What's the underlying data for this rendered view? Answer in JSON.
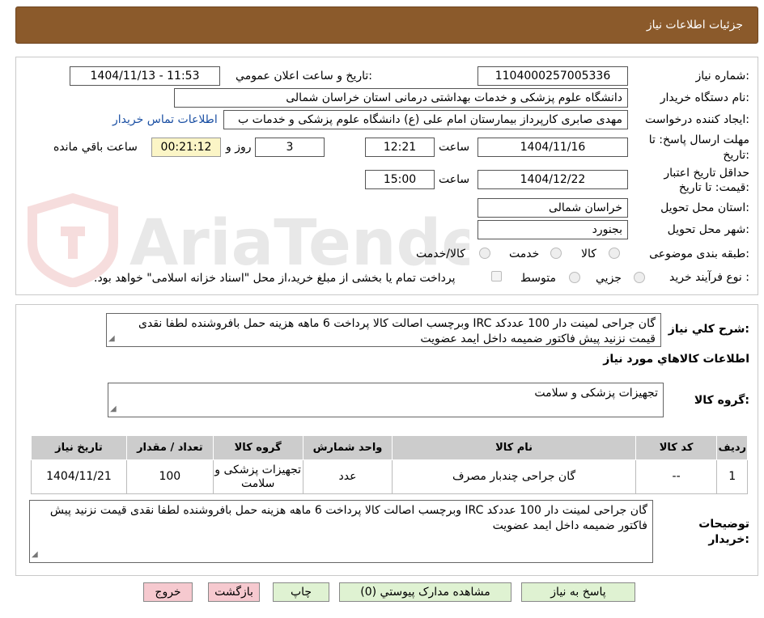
{
  "header": {
    "title": "جزئیات اطلاعات نیاز"
  },
  "form": {
    "need_number_label": "شماره نیاز:",
    "need_number": "1104000257005336",
    "announce_label": "تاریخ و ساعت اعلان عمومي:",
    "announce_value": "1404/11/13 - 11:53",
    "buyer_org_label": "نام دستگاه خریدار:",
    "buyer_org": "دانشگاه علوم پزشکی و خدمات بهداشتی درمانی استان خراسان شمالی",
    "requester_label": "ایجاد کننده درخواست:",
    "requester": "مهدی صابری کارپرداز بیمارستان امام علی (ع) دانشگاه علوم پزشکی و خدمات ب",
    "contact_link": "اطلاعات تماس خریدار",
    "deadline_label_1": "مهلت ارسال پاسخ: تا",
    "deadline_label_2": "تاریخ:",
    "deadline_date": "1404/11/16",
    "time_label": "ساعت",
    "deadline_time": "12:21",
    "days": "3",
    "days_and_label": "روز و",
    "remaining_time": "00:21:12",
    "remaining_label": "ساعت باقي مانده",
    "validity_label_1": "حداقل تاریخ اعتبار",
    "validity_label_2": "قیمت: تا تاریخ:",
    "validity_date": "1404/12/22",
    "validity_time": "15:00",
    "province_label": "استان محل تحویل:",
    "province": "خراسان شمالی",
    "city_label": "شهر محل تحویل:",
    "city": "بجنورد",
    "category_label": "طبقه بندی موضوعی:",
    "category_options": [
      "کالا",
      "خدمت",
      "کالا/خدمت"
    ],
    "process_label": "نوع فرآیند خرید :",
    "process_options": [
      "جزیي",
      "متوسط"
    ],
    "payment_note": "پرداخت تمام یا بخشی از مبلغ خرید،از محل \"اسناد خزانه اسلامی\" خواهد بود."
  },
  "watermark": {
    "text": "AriaTender.neT"
  },
  "description": {
    "label": "شرح کلي نیاز:",
    "text": "گان جراحی لمینت دار 100 عددکد IRC وبرچسب اصالت کالا پرداخت 6 ماهه هزینه حمل بافروشنده لطفا نقدی قیمت نزنید  پیش فاکتور ضمیمه داخل ایمد عضویت"
  },
  "goods_info": {
    "title": "اطلاعات کالاهاي مورد نیاز",
    "group_label": "گروه کالا:",
    "group_value": "تجهیزات پزشکی و سلامت"
  },
  "table": {
    "headers": [
      "ردیف",
      "کد کالا",
      "نام کالا",
      "واحد شمارش",
      "گروه کالا",
      "تعداد / مقدار",
      "تاریخ نیاز"
    ],
    "rows": [
      {
        "row": "1",
        "code": "--",
        "name": "گان جراحی چندبار مصرف",
        "unit": "عدد",
        "group": "تجهیزات پزشکی و سلامت",
        "qty": "100",
        "date": "1404/11/21"
      }
    ]
  },
  "buyer_notes": {
    "label_1": "توضیحات",
    "label_2": "خریدار:",
    "text": "گان جراحی لمینت دار 100 عددکد IRC وبرچسب اصالت کالا پرداخت 6 ماهه هزینه حمل بافروشنده لطفا نقدی قیمت نزنید پیش فاکتور ضمیمه داخل ایمد عضویت"
  },
  "buttons": {
    "reply": "پاسخ به نیاز",
    "attachments": "مشاهده مدارک پیوستي (0)",
    "print": "چاپ",
    "back": "بازگشت",
    "exit": "خروج"
  },
  "colors": {
    "header_bg": "#8b5a2b",
    "remaining_bg": "#fbf5c6",
    "btn_green": "#dff2d2",
    "btn_pink": "#f6c9cf"
  }
}
